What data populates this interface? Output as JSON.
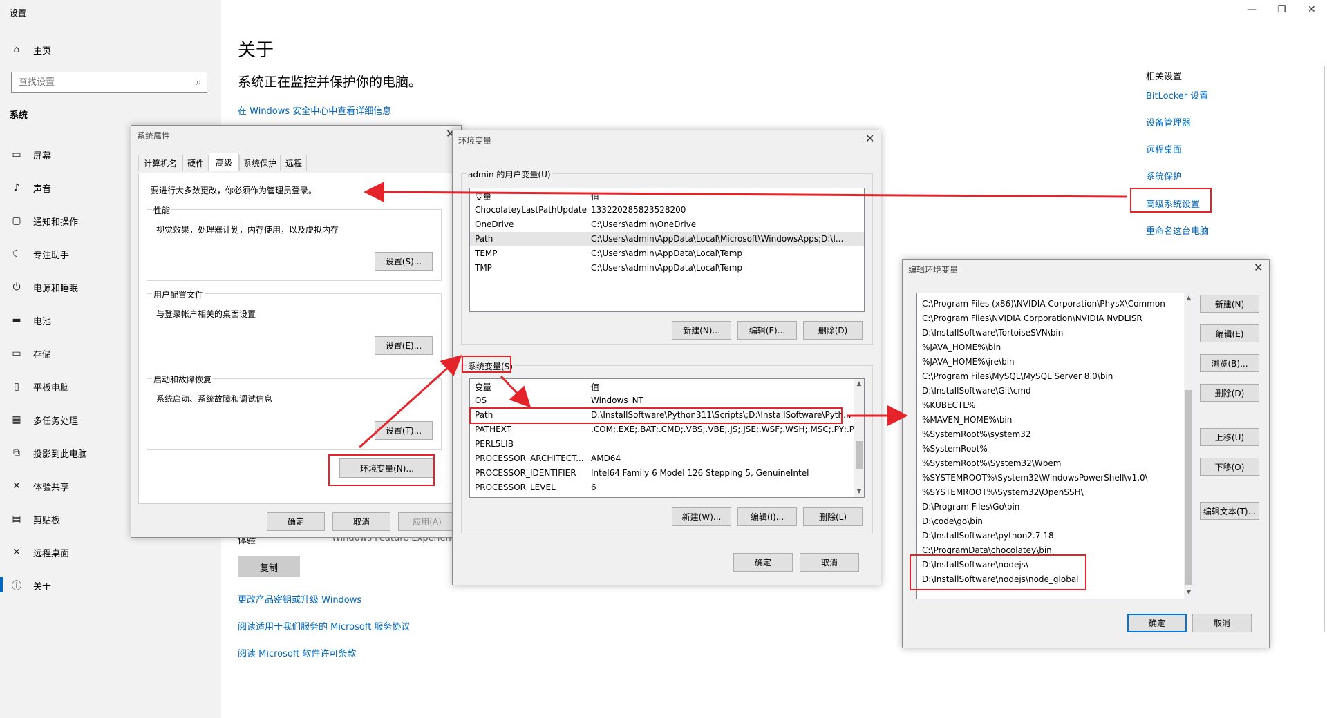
{
  "settings": {
    "window_title": "设置",
    "controls": {
      "minimize": "—",
      "restore": "❐",
      "close": "✕"
    },
    "sidebar": {
      "home_label": "主页",
      "search_placeholder": "查找设置",
      "section_label": "系统",
      "items": [
        {
          "label": "屏幕",
          "icon": "monitor-icon"
        },
        {
          "label": "声音",
          "icon": "speaker-icon"
        },
        {
          "label": "通知和操作",
          "icon": "notification-icon"
        },
        {
          "label": "专注助手",
          "icon": "moon-icon"
        },
        {
          "label": "电源和睡眠",
          "icon": "power-icon"
        },
        {
          "label": "电池",
          "icon": "battery-icon"
        },
        {
          "label": "存储",
          "icon": "storage-icon"
        },
        {
          "label": "平板电脑",
          "icon": "tablet-icon"
        },
        {
          "label": "多任务处理",
          "icon": "multitask-icon"
        },
        {
          "label": "投影到此电脑",
          "icon": "projection-icon"
        },
        {
          "label": "体验共享",
          "icon": "share-icon"
        },
        {
          "label": "剪贴板",
          "icon": "clipboard-icon"
        },
        {
          "label": "远程桌面",
          "icon": "remote-icon"
        },
        {
          "label": "关于",
          "icon": "info-icon"
        }
      ]
    },
    "main": {
      "title": "关于",
      "subtitle": "系统正在监控并保护你的电脑。",
      "security_link": "在 Windows 安全中心中查看详细信息",
      "partial_label": "体验",
      "partial_value": "Windows Feature Experience",
      "copy_button": "复制",
      "links": [
        "更改产品密钥或升级 Windows",
        "阅读适用于我们服务的 Microsoft 服务协议",
        "阅读 Microsoft 软件许可条款"
      ]
    },
    "related": {
      "title": "相关设置",
      "links": [
        "BitLocker 设置",
        "设备管理器",
        "远程桌面",
        "系统保护",
        "高级系统设置",
        "重命名这台电脑"
      ]
    }
  },
  "sysprops": {
    "title": "系统属性",
    "close": "✕",
    "tabs": [
      "计算机名",
      "硬件",
      "高级",
      "系统保护",
      "远程"
    ],
    "admin_note": "要进行大多数更改，你必须作为管理员登录。",
    "groups": [
      {
        "label": "性能",
        "desc": "视觉效果，处理器计划，内存使用，以及虚拟内存",
        "button": "设置(S)..."
      },
      {
        "label": "用户配置文件",
        "desc": "与登录帐户相关的桌面设置",
        "button": "设置(E)..."
      },
      {
        "label": "启动和故障恢复",
        "desc": "系统启动、系统故障和调试信息",
        "button": "设置(T)..."
      }
    ],
    "env_button": "环境变量(N)...",
    "ok": "确定",
    "cancel": "取消",
    "apply": "应用(A)"
  },
  "envvars": {
    "title": "环境变量",
    "close": "✕",
    "user_group": "admin 的用户变量(U)",
    "col_var": "变量",
    "col_val": "值",
    "user_rows": [
      {
        "name": "ChocolateyLastPathUpdate",
        "value": "133220285823528200"
      },
      {
        "name": "OneDrive",
        "value": "C:\\Users\\admin\\OneDrive"
      },
      {
        "name": "Path",
        "value": "C:\\Users\\admin\\AppData\\Local\\Microsoft\\WindowsApps;D:\\I..."
      },
      {
        "name": "TEMP",
        "value": "C:\\Users\\admin\\AppData\\Local\\Temp"
      },
      {
        "name": "TMP",
        "value": "C:\\Users\\admin\\AppData\\Local\\Temp"
      }
    ],
    "sys_group": "系统变量(S)",
    "sys_rows": [
      {
        "name": "OS",
        "value": "Windows_NT"
      },
      {
        "name": "Path",
        "value": "D:\\InstallSoftware\\Python311\\Scripts\\;D:\\InstallSoftware\\Pyth..."
      },
      {
        "name": "PATHEXT",
        "value": ".COM;.EXE;.BAT;.CMD;.VBS;.VBE;.JS;.JSE;.WSF;.WSH;.MSC;.PY;.P..."
      },
      {
        "name": "PERL5LIB",
        "value": ""
      },
      {
        "name": "PROCESSOR_ARCHITECT...",
        "value": "AMD64"
      },
      {
        "name": "PROCESSOR_IDENTIFIER",
        "value": "Intel64 Family 6 Model 126 Stepping 5, GenuineIntel"
      },
      {
        "name": "PROCESSOR_LEVEL",
        "value": "6"
      }
    ],
    "new_user": "新建(N)...",
    "edit_user": "编辑(E)...",
    "delete_user": "删除(D)",
    "new_sys": "新建(W)...",
    "edit_sys": "编辑(I)...",
    "delete_sys": "删除(L)",
    "ok": "确定",
    "cancel": "取消"
  },
  "editenv": {
    "title": "编辑环境变量",
    "close": "✕",
    "entries": [
      "C:\\Program Files (x86)\\NVIDIA Corporation\\PhysX\\Common",
      "C:\\Program Files\\NVIDIA Corporation\\NVIDIA NvDLISR",
      "D:\\InstallSoftware\\TortoiseSVN\\bin",
      "%JAVA_HOME%\\bin",
      "%JAVA_HOME%\\jre\\bin",
      "C:\\Program Files\\MySQL\\MySQL Server 8.0\\bin",
      "D:\\InstallSoftware\\Git\\cmd",
      "%KUBECTL%",
      "%MAVEN_HOME%\\bin",
      "%SystemRoot%\\system32",
      "%SystemRoot%",
      "%SystemRoot%\\System32\\Wbem",
      "%SYSTEMROOT%\\System32\\WindowsPowerShell\\v1.0\\",
      "%SYSTEMROOT%\\System32\\OpenSSH\\",
      "D:\\Program Files\\Go\\bin",
      "D:\\code\\go\\bin",
      "D:\\InstallSoftware\\python2.7.18",
      "C:\\ProgramData\\chocolatey\\bin",
      "D:\\InstallSoftware\\nodejs\\",
      "D:\\InstallSoftware\\nodejs\\node_global"
    ],
    "buttons": [
      "新建(N)",
      "编辑(E)",
      "浏览(B)...",
      "删除(D)",
      "上移(U)",
      "下移(O)",
      "编辑文本(T)..."
    ],
    "ok": "确定",
    "cancel": "取消"
  }
}
